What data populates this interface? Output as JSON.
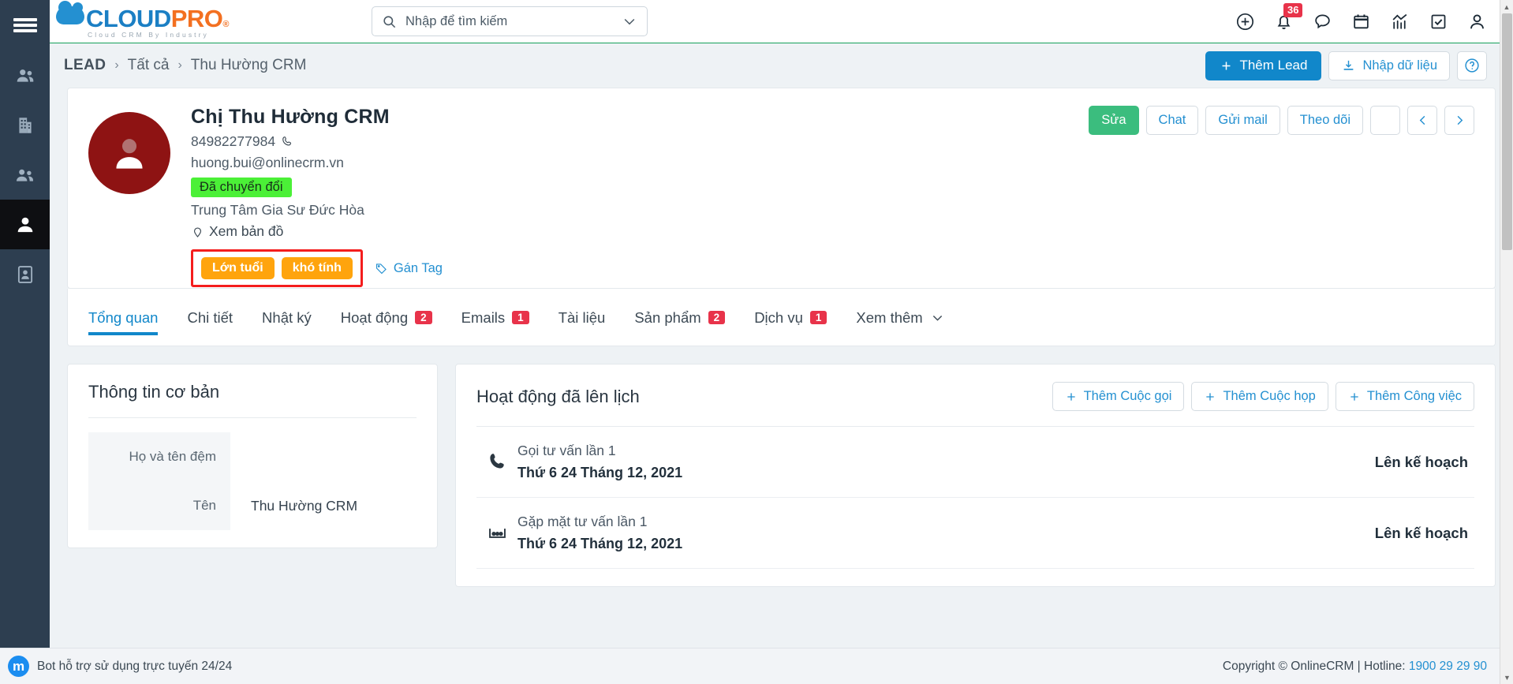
{
  "rail": {
    "menu_icon": "hamburger-menu-icon",
    "items": [
      {
        "name": "contacts-group-icon",
        "active": false
      },
      {
        "name": "company-building-icon",
        "active": false
      },
      {
        "name": "customer-icon",
        "active": false
      },
      {
        "name": "lead-person-icon",
        "active": true
      },
      {
        "name": "document-person-icon",
        "active": false
      }
    ]
  },
  "header": {
    "logo": {
      "cloud": "CLOUD",
      "pro": "PRO",
      "reg": "®",
      "tagline": "Cloud CRM By Industry"
    },
    "search": {
      "placeholder": "Nhập để tìm kiếm",
      "icon": "search-icon",
      "caret": "chevron-down-icon"
    },
    "icons": [
      {
        "name": "plus-circle-icon",
        "badge": ""
      },
      {
        "name": "bell-notification-icon",
        "badge": "36"
      },
      {
        "name": "chat-bubble-icon",
        "badge": ""
      },
      {
        "name": "calendar-icon",
        "badge": ""
      },
      {
        "name": "analytics-chart-icon",
        "badge": ""
      },
      {
        "name": "task-checkbox-icon",
        "badge": ""
      },
      {
        "name": "user-account-icon",
        "badge": ""
      }
    ]
  },
  "breadcrumb": {
    "root": "LEAD",
    "sep": "›",
    "middle": "Tất cả",
    "current": "Thu Hường CRM"
  },
  "page_actions": {
    "add_lead": "Thêm Lead",
    "import": "Nhập dữ liệu",
    "help": "?"
  },
  "profile": {
    "name": "Chị Thu Hường CRM",
    "phone": "84982277984",
    "email": "huong.bui@onlinecrm.vn",
    "status_badge": "Đã chuyển đổi",
    "company": "Trung Tâm Gia Sư Đức Hòa",
    "map_link": "Xem bản đồ",
    "tags": [
      "Lớn tuổi",
      "khó tính"
    ],
    "assign_tag": "Gán Tag",
    "actions": {
      "edit": "Sửa",
      "chat": "Chat",
      "send_mail": "Gửi mail",
      "follow": "Theo dõi",
      "more": "kebab-menu-icon",
      "prev": "‹",
      "next": "›"
    }
  },
  "tabs": [
    {
      "label": "Tổng quan",
      "badge": "",
      "active": true
    },
    {
      "label": "Chi tiết",
      "badge": "",
      "active": false
    },
    {
      "label": "Nhật ký",
      "badge": "",
      "active": false
    },
    {
      "label": "Hoạt động",
      "badge": "2",
      "active": false
    },
    {
      "label": "Emails",
      "badge": "1",
      "active": false
    },
    {
      "label": "Tài liệu",
      "badge": "",
      "active": false
    },
    {
      "label": "Sản phẩm",
      "badge": "2",
      "active": false
    },
    {
      "label": "Dịch vụ",
      "badge": "1",
      "active": false
    },
    {
      "label": "Xem thêm",
      "badge": "",
      "active": false,
      "caret": true
    }
  ],
  "basic_info": {
    "title": "Thông tin cơ bản",
    "fields": [
      {
        "label": "Họ và tên đệm",
        "value": ""
      },
      {
        "label": "Tên",
        "value": "Thu Hường CRM"
      }
    ]
  },
  "scheduled": {
    "title": "Hoạt động đã lên lịch",
    "buttons": [
      {
        "label": "Thêm Cuộc gọi"
      },
      {
        "label": "Thêm Cuộc họp"
      },
      {
        "label": "Thêm Công việc"
      }
    ],
    "rows": [
      {
        "icon": "phone-call-icon",
        "title": "Gọi tư vấn lần 1",
        "date": "Thứ 6 24 Tháng 12, 2021",
        "status": "Lên kế hoạch"
      },
      {
        "icon": "meeting-people-icon",
        "title": "Gặp mặt tư vấn lần 1",
        "date": "Thứ 6 24 Tháng 12, 2021",
        "status": "Lên kế hoạch"
      }
    ]
  },
  "footer": {
    "bot_text": "Bot hỗ trợ sử dụng trực tuyến 24/24",
    "copyright": "Copyright © OnlineCRM | Hotline: ",
    "hotline": "1900 29 29 90"
  },
  "colors": {
    "accent_blue": "#1187ca",
    "green_badge": "#4bf037",
    "orange_tag": "#ffa40d",
    "red_badge": "#e8334a",
    "rail_dark": "#2d3e50",
    "edit_green": "#3bbd7e",
    "highlight_red": "#f41d1d"
  }
}
